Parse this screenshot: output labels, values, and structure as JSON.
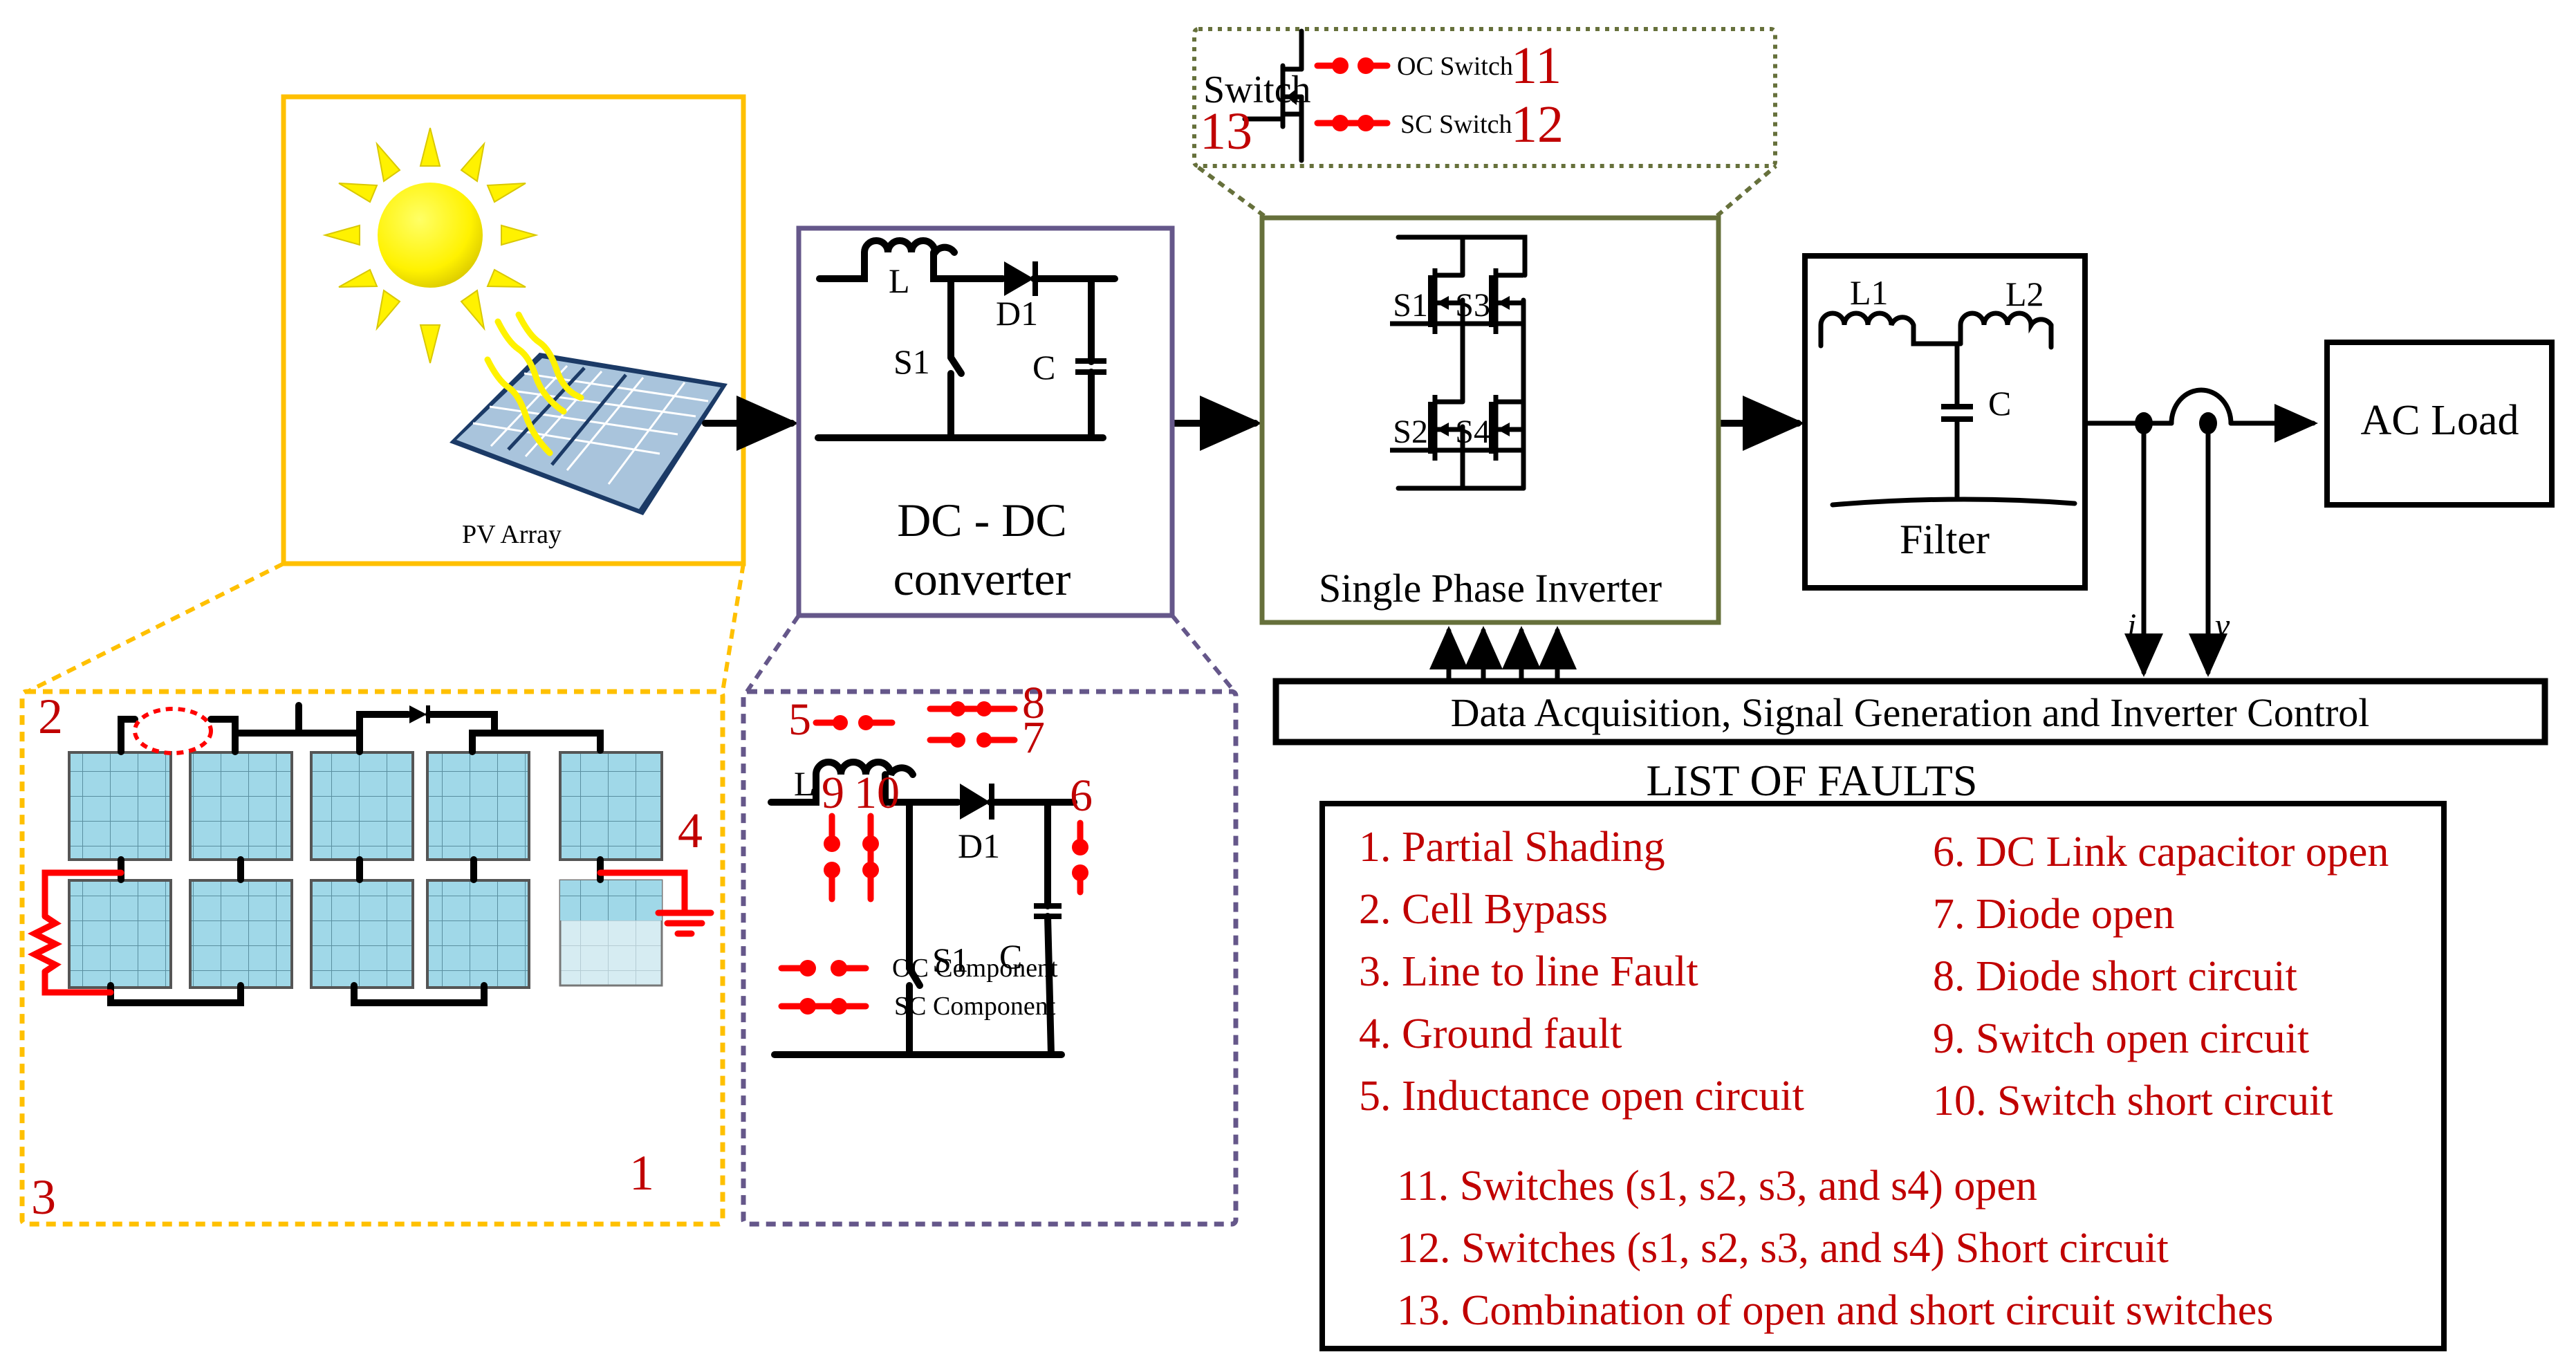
{
  "colors": {
    "pv_border": "#FFC000",
    "dcdc_border": "#65578A",
    "inverter_border": "#66703B",
    "fault_text": "#C00000",
    "fault_marker": "#FF0000",
    "sun": "#FFFF00",
    "pv_cell": "#A0D8E8"
  },
  "pv_array": {
    "label": "PV Array",
    "detail": {
      "fault_markers": [
        "1",
        "2",
        "3",
        "4"
      ]
    }
  },
  "dcdc": {
    "title_line1": "DC - DC",
    "title_line2": "converter",
    "inductor_label": "L",
    "diode_label": "D1",
    "switch_label": "S1",
    "capacitor_label": "C",
    "detail": {
      "inductor_label": "L",
      "diode_label": "D1",
      "switch_label": "S1",
      "capacitor_label": "C",
      "fault_markers": {
        "inductor_open": "5",
        "cap_open": "6",
        "diode_open": "7",
        "diode_short": "8",
        "switch_open": "9",
        "switch_short": "10"
      },
      "legend": {
        "oc": "OC Component",
        "sc": "SC Component"
      }
    }
  },
  "inverter": {
    "title": "Single Phase Inverter",
    "switches": [
      "S1",
      "S2",
      "S3",
      "S4"
    ],
    "detail": {
      "switch_label": "Switch",
      "oc_label": "OC Switch",
      "sc_label": "SC Switch",
      "marker_oc": "11",
      "marker_sc": "12",
      "marker_combo": "13"
    }
  },
  "filter": {
    "title": "Filter",
    "l1": "L1",
    "l2": "L2",
    "c": "C"
  },
  "load": {
    "label": "AC Load"
  },
  "signals": {
    "current": "i",
    "voltage": "v"
  },
  "control": {
    "label": "Data Acquisition, Signal Generation and Inverter Control"
  },
  "faults": {
    "title": "LIST OF FAULTS",
    "left": [
      "1. Partial Shading",
      "2. Cell Bypass",
      "3. Line to line Fault",
      "4. Ground fault",
      "5. Inductance open circuit"
    ],
    "right": [
      "6. DC Link capacitor open",
      "7. Diode open",
      "8. Diode short circuit",
      "9. Switch open circuit",
      "10. Switch short circuit"
    ],
    "bottom": [
      "11. Switches (s1, s2, s3, and s4) open",
      "12. Switches (s1, s2, s3, and s4) Short circuit",
      "13. Combination of open and short circuit switches"
    ]
  }
}
